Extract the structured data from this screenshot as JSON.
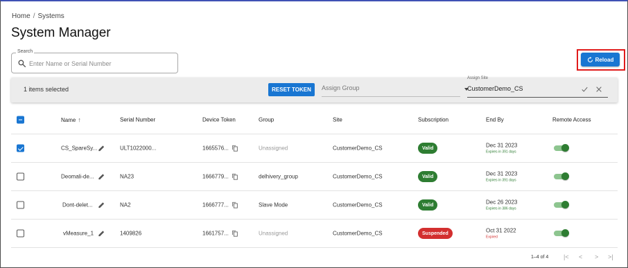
{
  "breadcrumb": {
    "home": "Home",
    "separator": "/",
    "current": "Systems"
  },
  "page_title": "System Manager",
  "search": {
    "legend": "Search",
    "placeholder": "Enter Name or Serial Number",
    "value": ""
  },
  "reload_button": {
    "label": "Reload",
    "icon": "refresh-icon"
  },
  "selection_bar": {
    "count_text": "1 items selected",
    "reset_token_label": "RESET TOKEN",
    "assign_group_placeholder": "Assign Group",
    "assign_site_label": "Assign Site",
    "assign_site_value": "CustomerDemo_CS"
  },
  "table": {
    "columns": [
      "Name",
      "Serial Number",
      "Device Token",
      "Group",
      "Site",
      "Subscription",
      "End By",
      "Remote Access"
    ],
    "sort_indicator": "↑",
    "rows": [
      {
        "checked": true,
        "name": "CS_SpareSy...",
        "serial": "ULT1022000...",
        "token": "1665576...",
        "group": "Unassigned",
        "group_muted": true,
        "site": "CustomerDemo_CS",
        "subscription": "Valid",
        "sub_status": "valid",
        "end_date": "Dec 31 2023",
        "end_note": "Expires in 391 days",
        "note_status": "ok",
        "remote_access": true
      },
      {
        "checked": false,
        "name": "Deomali-de...",
        "serial": "NA23",
        "token": "1666779...",
        "group": "delhivery_group",
        "group_muted": false,
        "site": "CustomerDemo_CS",
        "subscription": "Valid",
        "sub_status": "valid",
        "end_date": "Dec 31 2023",
        "end_note": "Expires in 391 days",
        "note_status": "ok",
        "remote_access": true
      },
      {
        "checked": false,
        "name": "Dont-delet...",
        "serial": "NA2",
        "token": "1666777...",
        "group": "Slave Mode",
        "group_muted": false,
        "site": "CustomerDemo_CS",
        "subscription": "Valid",
        "sub_status": "valid",
        "end_date": "Dec 26 2023",
        "end_note": "Expires in 386 days",
        "note_status": "ok",
        "remote_access": true
      },
      {
        "checked": false,
        "name": "vMeasure_1",
        "serial": "1409826",
        "token": "1661757...",
        "group": "Unassigned",
        "group_muted": true,
        "site": "CustomerDemo_CS",
        "subscription": "Suspended",
        "sub_status": "suspended",
        "end_date": "Oct 31 2022",
        "end_note": "Expired",
        "note_status": "bad",
        "remote_access": true
      }
    ]
  },
  "pagination": {
    "range_text": "1–4 of 4",
    "first": "|<",
    "prev": "<",
    "next": ">",
    "last": ">|"
  },
  "colors": {
    "primary": "#1976d2",
    "valid": "#2e7d32",
    "suspended": "#d32f2f",
    "highlight": "#e01b1b"
  }
}
